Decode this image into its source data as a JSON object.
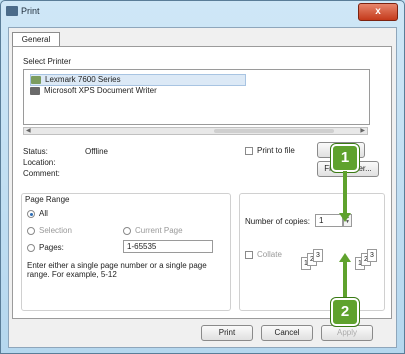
{
  "window": {
    "title": "Print",
    "close_glyph": "x"
  },
  "tabs": [
    {
      "label": "General"
    }
  ],
  "printer_section": {
    "label": "Select Printer",
    "printers": [
      {
        "name": "Lexmark 7600 Series",
        "selected": true
      },
      {
        "name": "Microsoft XPS Document Writer",
        "selected": false
      }
    ]
  },
  "status": {
    "status_label": "Status:",
    "status_value": "Offline",
    "location_label": "Location:",
    "location_value": "",
    "comment_label": "Comment:",
    "comment_value": ""
  },
  "buttons": {
    "print_to_file": "Print to file",
    "preferences": "Pr",
    "find_printer": "Find Printer...",
    "print": "Print",
    "cancel": "Cancel",
    "apply": "Apply"
  },
  "page_range": {
    "label": "Page Range",
    "all": "All",
    "selection": "Selection",
    "current_page": "Current Page",
    "pages": "Pages:",
    "pages_value": "1-65535",
    "hint": "Enter either a single page number or a single page range.  For example, 5-12"
  },
  "copies": {
    "label": "Number of copies:",
    "value": "1",
    "collate": "Collate",
    "collate_pages": [
      "1",
      "2",
      "3"
    ]
  },
  "callouts": {
    "one": "1",
    "two": "2"
  },
  "colors": {
    "callout_green": "#5fa22d",
    "close_red": "#c43a1b"
  }
}
